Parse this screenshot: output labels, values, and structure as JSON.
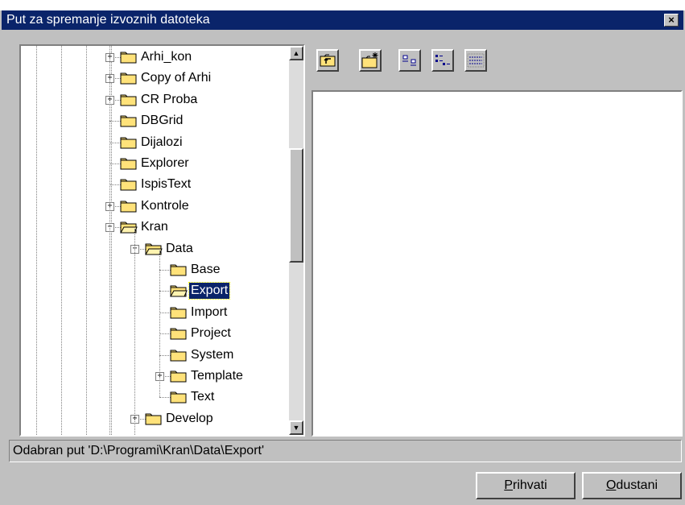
{
  "window": {
    "title": "Put za spremanje izvoznih datoteka",
    "close_glyph": "×"
  },
  "tree": {
    "nodes": [
      {
        "label": "Arhi_kon",
        "expander": "+",
        "selected": false,
        "icon": "folder-icon"
      },
      {
        "label": "Copy of Arhi",
        "expander": "+",
        "selected": false,
        "icon": "folder-icon"
      },
      {
        "label": "CR Proba",
        "expander": "+",
        "selected": false,
        "icon": "folder-icon"
      },
      {
        "label": "DBGrid",
        "expander": "",
        "selected": false,
        "icon": "folder-icon"
      },
      {
        "label": "Dijalozi",
        "expander": "",
        "selected": false,
        "icon": "folder-icon"
      },
      {
        "label": "Explorer",
        "expander": "",
        "selected": false,
        "icon": "folder-icon"
      },
      {
        "label": "IspisText",
        "expander": "",
        "selected": false,
        "icon": "folder-icon"
      },
      {
        "label": "Kontrole",
        "expander": "+",
        "selected": false,
        "icon": "folder-icon"
      },
      {
        "label": "Kran",
        "expander": "−",
        "selected": false,
        "icon": "folder-open-icon"
      },
      {
        "label": "Data",
        "expander": "−",
        "selected": false,
        "icon": "folder-open-icon"
      },
      {
        "label": "Base",
        "expander": "",
        "selected": false,
        "icon": "folder-icon"
      },
      {
        "label": "Export",
        "expander": "",
        "selected": true,
        "icon": "folder-open-icon"
      },
      {
        "label": "Import",
        "expander": "",
        "selected": false,
        "icon": "folder-icon"
      },
      {
        "label": "Project",
        "expander": "",
        "selected": false,
        "icon": "folder-icon"
      },
      {
        "label": "System",
        "expander": "",
        "selected": false,
        "icon": "folder-icon"
      },
      {
        "label": "Template",
        "expander": "+",
        "selected": false,
        "icon": "folder-icon"
      },
      {
        "label": "Text",
        "expander": "",
        "selected": false,
        "icon": "folder-icon"
      },
      {
        "label": "Develop",
        "expander": "+",
        "selected": false,
        "icon": "folder-icon"
      }
    ]
  },
  "toolbar": {
    "buttons": [
      {
        "icon": "up-one-level-icon"
      },
      {
        "icon": "new-folder-icon"
      },
      {
        "icon": "large-icons-view-icon"
      },
      {
        "icon": "list-view-icon"
      },
      {
        "icon": "details-view-icon"
      }
    ]
  },
  "scrollbar": {
    "up_glyph": "▲",
    "down_glyph": "▼"
  },
  "status": {
    "text": "Odabran put 'D:\\Programi\\Kran\\Data\\Export'"
  },
  "buttons": {
    "accept": {
      "mnemonic": "P",
      "rest": "rihvati"
    },
    "cancel": {
      "mnemonic": "O",
      "rest": "dustani"
    }
  },
  "colors": {
    "titlebar": "#0a246a",
    "face": "#c0c0c0",
    "selection": "#0a246a",
    "folder": "#ffe27a"
  }
}
